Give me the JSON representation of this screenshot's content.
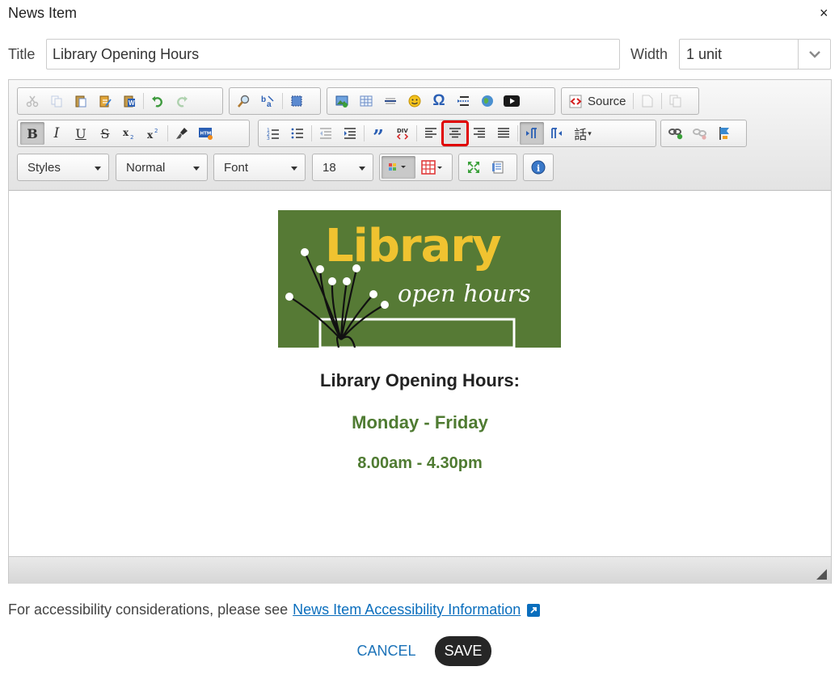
{
  "dialog": {
    "title": "News Item",
    "close_symbol": "×"
  },
  "form": {
    "title_label": "Title",
    "title_value": "Library Opening Hours",
    "width_label": "Width",
    "width_value": "1 unit"
  },
  "toolbar": {
    "source_label": "Source",
    "combos": {
      "styles": "Styles",
      "format": "Normal",
      "font": "Font",
      "size": "18"
    }
  },
  "content": {
    "banner": {
      "line1": "Library",
      "line2": "open hours"
    },
    "heading": "Library Opening Hours:",
    "days": "Monday - Friday",
    "hours": "8.00am - 4.30pm",
    "heading_color": "#222222",
    "accent_color": "#4f7b32"
  },
  "footer": {
    "a11y_text": "For accessibility considerations, please see",
    "a11y_link": "News Item Accessibility Information",
    "cancel_label": "CANCEL",
    "save_label": "SAVE"
  },
  "icons": {
    "close": "close-icon",
    "dropdown": "chevron-down-icon",
    "cut": "cut-icon",
    "copy": "copy-icon",
    "paste": "paste-icon",
    "paste_text": "paste-text-icon",
    "paste_word": "paste-from-word-icon",
    "undo": "undo-icon",
    "redo": "redo-icon",
    "find": "find-icon",
    "replace": "replace-icon",
    "select_all": "select-all-icon",
    "image": "image-icon",
    "table": "table-icon",
    "hr": "horizontal-rule-icon",
    "smiley": "smiley-icon",
    "special_char": "special-character-icon",
    "page_break": "page-break-icon",
    "iframe": "iframe-globe-icon",
    "youtube": "youtube-icon",
    "source": "source-icon",
    "new_page": "new-page-icon",
    "templates": "templates-icon",
    "bold": "bold-icon",
    "italic": "italic-icon",
    "underline": "underline-icon",
    "strike": "strikethrough-icon",
    "subscript": "subscript-icon",
    "superscript": "superscript-icon",
    "remove_format": "remove-format-icon",
    "html5": "html5-icon",
    "numbered_list": "numbered-list-icon",
    "bulleted_list": "bulleted-list-icon",
    "outdent": "outdent-icon",
    "indent": "indent-icon",
    "blockquote": "blockquote-icon",
    "div": "div-container-icon",
    "align_left": "align-left-icon",
    "align_center": "align-center-icon",
    "align_right": "align-right-icon",
    "justify": "justify-icon",
    "ltr": "text-direction-ltr-icon",
    "rtl": "text-direction-rtl-icon",
    "language": "language-icon",
    "link": "link-icon",
    "unlink": "unlink-icon",
    "anchor": "anchor-flag-icon",
    "text_color": "text-color-icon",
    "bg_color": "background-color-icon",
    "maximize": "maximize-icon",
    "show_blocks": "show-blocks-icon",
    "about": "about-info-icon",
    "resize": "resize-handle-icon",
    "external": "external-link-icon"
  }
}
